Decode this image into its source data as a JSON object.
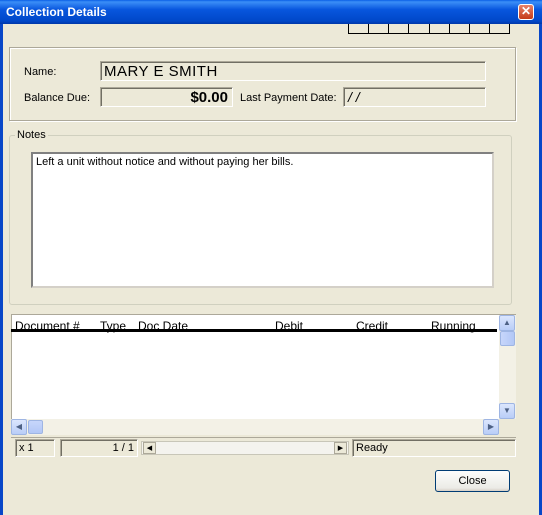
{
  "window": {
    "title": "Collection Details",
    "close_glyph": "✕"
  },
  "customer": {
    "name_label": "Name:",
    "name_value": "MARY E SMITH",
    "balance_label": "Balance Due:",
    "balance_value": "$0.00",
    "last_payment_label": "Last Payment Date:",
    "last_payment_value": "/ /"
  },
  "notes": {
    "legend": "Notes",
    "text": "Left a unit without notice and without paying her bills."
  },
  "grid": {
    "columns": [
      "Document #",
      "Type",
      "Doc Date",
      "Debit",
      "Credit",
      "Running"
    ],
    "rows": []
  },
  "scroll_glyphs": {
    "up": "▲",
    "down": "▼",
    "left": "◀",
    "right": "▶"
  },
  "status": {
    "zoom": "x 1",
    "page": "1 / 1",
    "state": "Ready"
  },
  "buttons": {
    "close_label": "Close"
  },
  "icons": {
    "close": "close-icon",
    "scroll_up": "chevron-up-icon",
    "scroll_down": "chevron-down-icon",
    "scroll_left": "chevron-left-icon",
    "scroll_right": "chevron-right-icon"
  },
  "colors": {
    "titlebar": "#0856de",
    "face": "#ece9d8",
    "close_button": "#c43a18"
  }
}
